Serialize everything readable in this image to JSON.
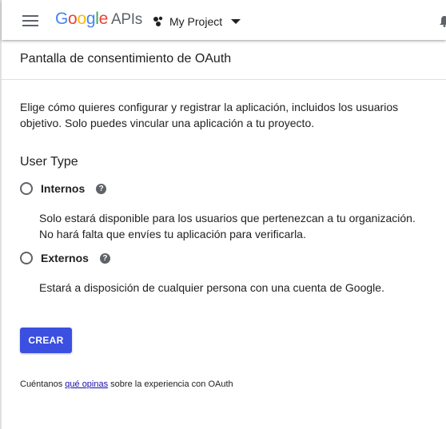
{
  "header": {
    "logo_google": "Google",
    "logo_apis": "APIs",
    "project_name": "My Project"
  },
  "page": {
    "title": "Pantalla de consentimiento de OAuth",
    "intro": "Elige cómo quieres configurar y registrar la aplicación, incluidos los usuarios objetivo. Solo puedes vincular una aplicación a tu proyecto."
  },
  "user_type": {
    "title": "User Type",
    "options": [
      {
        "label": "Internos",
        "description": "Solo estará disponible para los usuarios que pertenezcan a tu organización. No hará falta que envíes tu aplicación para verificarla.",
        "selected": false
      },
      {
        "label": "Externos",
        "description": "Estará a disposición de cualquier persona con una cuenta de Google.",
        "selected": false
      }
    ],
    "help_glyph": "?"
  },
  "actions": {
    "create_label": "CREAR"
  },
  "feedback": {
    "prefix": "Cuéntanos",
    "link": "qué opinas",
    "suffix": "sobre la experiencia con OAuth"
  },
  "colors": {
    "primary_button": "#3b4fe0",
    "link": "#1a0dab"
  }
}
